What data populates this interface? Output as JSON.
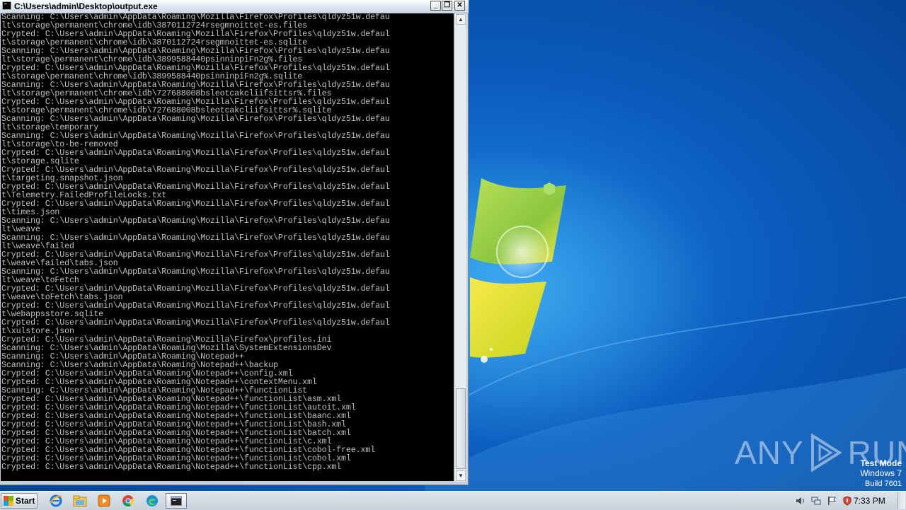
{
  "window": {
    "title": "C:\\Users\\admin\\Desktop\\output.exe",
    "minimize_symbol": "_",
    "maximize_symbol": "❐",
    "close_symbol": "✕"
  },
  "console": {
    "text": "Scanning: C:\\Users\\admin\\AppData\\Roaming\\Mozilla\\Firefox\\Profiles\\qldyz51w.defau\nlt\\storage\\permanent\\chrome\\idb\\3870112724rsegmnoittet-es.files\nCrypted: C:\\Users\\admin\\AppData\\Roaming\\Mozilla\\Firefox\\Profiles\\qldyz51w.defaul\nt\\storage\\permanent\\chrome\\idb\\3870112724rsegmnoittet-es.sqlite\nScanning: C:\\Users\\admin\\AppData\\Roaming\\Mozilla\\Firefox\\Profiles\\qldyz51w.defau\nlt\\storage\\permanent\\chrome\\idb\\3899588440psinninpiFn2g%.files\nCrypted: C:\\Users\\admin\\AppData\\Roaming\\Mozilla\\Firefox\\Profiles\\qldyz51w.defaul\nt\\storage\\permanent\\chrome\\idb\\3899588440psinninpiFn2g%.sqlite\nScanning: C:\\Users\\admin\\AppData\\Roaming\\Mozilla\\Firefox\\Profiles\\qldyz51w.defau\nlt\\storage\\permanent\\chrome\\idb\\727688008bsleotcakcliifsittsr%.files\nCrypted: C:\\Users\\admin\\AppData\\Roaming\\Mozilla\\Firefox\\Profiles\\qldyz51w.defaul\nt\\storage\\permanent\\chrome\\idb\\727688008bsleotcakcliifsittsr%.sqlite\nScanning: C:\\Users\\admin\\AppData\\Roaming\\Mozilla\\Firefox\\Profiles\\qldyz51w.defau\nlt\\storage\\temporary\nScanning: C:\\Users\\admin\\AppData\\Roaming\\Mozilla\\Firefox\\Profiles\\qldyz51w.defau\nlt\\storage\\to-be-removed\nCrypted: C:\\Users\\admin\\AppData\\Roaming\\Mozilla\\Firefox\\Profiles\\qldyz51w.defaul\nt\\storage.sqlite\nCrypted: C:\\Users\\admin\\AppData\\Roaming\\Mozilla\\Firefox\\Profiles\\qldyz51w.defaul\nt\\targeting.snapshot.json\nCrypted: C:\\Users\\admin\\AppData\\Roaming\\Mozilla\\Firefox\\Profiles\\qldyz51w.defaul\nt\\Telemetry.FailedProfileLocks.txt\nCrypted: C:\\Users\\admin\\AppData\\Roaming\\Mozilla\\Firefox\\Profiles\\qldyz51w.defaul\nt\\times.json\nScanning: C:\\Users\\admin\\AppData\\Roaming\\Mozilla\\Firefox\\Profiles\\qldyz51w.defau\nlt\\weave\nScanning: C:\\Users\\admin\\AppData\\Roaming\\Mozilla\\Firefox\\Profiles\\qldyz51w.defau\nlt\\weave\\failed\nCrypted: C:\\Users\\admin\\AppData\\Roaming\\Mozilla\\Firefox\\Profiles\\qldyz51w.defaul\nt\\weave\\failed\\tabs.json\nScanning: C:\\Users\\admin\\AppData\\Roaming\\Mozilla\\Firefox\\Profiles\\qldyz51w.defau\nlt\\weave\\toFetch\nCrypted: C:\\Users\\admin\\AppData\\Roaming\\Mozilla\\Firefox\\Profiles\\qldyz51w.defaul\nt\\weave\\toFetch\\tabs.json\nCrypted: C:\\Users\\admin\\AppData\\Roaming\\Mozilla\\Firefox\\Profiles\\qldyz51w.defaul\nt\\webappsstore.sqlite\nCrypted: C:\\Users\\admin\\AppData\\Roaming\\Mozilla\\Firefox\\Profiles\\qldyz51w.defaul\nt\\xulstore.json\nCrypted: C:\\Users\\admin\\AppData\\Roaming\\Mozilla\\Firefox\\profiles.ini\nScanning: C:\\Users\\admin\\AppData\\Roaming\\Mozilla\\SystemExtensionsDev\nScanning: C:\\Users\\admin\\AppData\\Roaming\\Notepad++\nScanning: C:\\Users\\admin\\AppData\\Roaming\\Notepad++\\backup\nCrypted: C:\\Users\\admin\\AppData\\Roaming\\Notepad++\\config.xml\nCrypted: C:\\Users\\admin\\AppData\\Roaming\\Notepad++\\contextMenu.xml\nScanning: C:\\Users\\admin\\AppData\\Roaming\\Notepad++\\functionList\nCrypted: C:\\Users\\admin\\AppData\\Roaming\\Notepad++\\functionList\\asm.xml\nCrypted: C:\\Users\\admin\\AppData\\Roaming\\Notepad++\\functionList\\autoit.xml\nCrypted: C:\\Users\\admin\\AppData\\Roaming\\Notepad++\\functionList\\baanc.xml\nCrypted: C:\\Users\\admin\\AppData\\Roaming\\Notepad++\\functionList\\bash.xml\nCrypted: C:\\Users\\admin\\AppData\\Roaming\\Notepad++\\functionList\\batch.xml\nCrypted: C:\\Users\\admin\\AppData\\Roaming\\Notepad++\\functionList\\c.xml\nCrypted: C:\\Users\\admin\\AppData\\Roaming\\Notepad++\\functionList\\cobol-free.xml\nCrypted: C:\\Users\\admin\\AppData\\Roaming\\Notepad++\\functionList\\cobol.xml\nCrypted: C:\\Users\\admin\\AppData\\Roaming\\Notepad++\\functionList\\cpp.xml",
    "text_color": "#c0c0c0",
    "background": "#000000"
  },
  "watermark": {
    "left": "ANY",
    "right": "RUN"
  },
  "test_mode": {
    "line1": "Test Mode",
    "line2": "Windows 7",
    "line3": "Build 7601"
  },
  "taskbar": {
    "start_label": "Start",
    "pinned": [
      "ie-icon",
      "explorer-icon",
      "media-player-icon",
      "chrome-icon",
      "edge-icon"
    ],
    "active_task": "console-window",
    "tray_icons": [
      "volume-icon",
      "network-icon",
      "flag-icon",
      "security-icon"
    ],
    "clock": "7:33 PM"
  },
  "colors": {
    "desktop_blue": "#0b5bbd",
    "taskbar": "#c9d2dc"
  }
}
